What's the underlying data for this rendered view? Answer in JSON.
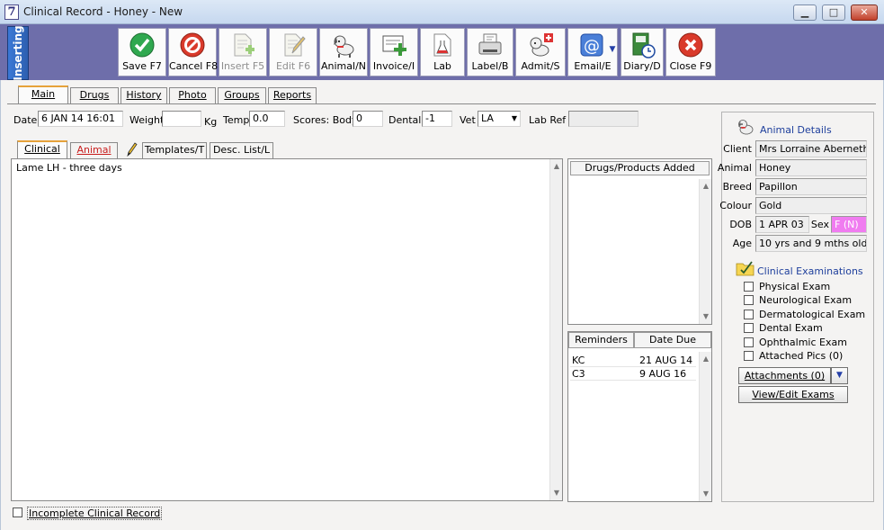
{
  "window": {
    "title": "Clinical Record - Honey - New",
    "icon_text": "7"
  },
  "mode_badge": "Inserting",
  "toolbar": [
    {
      "label": "Save F7",
      "icon": "check-icon",
      "color": "#2fa84f"
    },
    {
      "label": "Cancel F8",
      "icon": "cancel-icon",
      "color": "#d93a2b"
    },
    {
      "label": "Insert F5",
      "icon": "insert-document-icon",
      "disabled": true
    },
    {
      "label": "Edit F6",
      "icon": "edit-document-icon",
      "disabled": true
    },
    {
      "label": "Animal/N",
      "icon": "dog-icon"
    },
    {
      "label": "Invoice/I",
      "icon": "invoice-icon"
    },
    {
      "label": "Lab",
      "icon": "lab-flask-icon"
    },
    {
      "label": "Label/B",
      "icon": "label-printer-icon"
    },
    {
      "label": "Admit/S",
      "icon": "admit-dog-icon"
    },
    {
      "label": "Email/E",
      "icon": "email-at-icon"
    },
    {
      "label": "Diary/D",
      "icon": "diary-icon"
    },
    {
      "label": "Close F9",
      "icon": "close-x-icon",
      "color": "#d93a2b"
    }
  ],
  "main_tabs": [
    "Main",
    "Drugs",
    "History",
    "Photo",
    "Groups",
    "Reports"
  ],
  "record": {
    "date_label": "Date",
    "date_value": "6 JAN 14  16:01",
    "weight_label": "Weight",
    "weight_value": "",
    "weight_unit": "Kg",
    "temp_label": "Temp",
    "temp_value": "0.0",
    "scores_body_label": "Scores: Body",
    "scores_body_value": "0",
    "dental_label": "Dental",
    "dental_value": "-1",
    "vet_label": "Vet",
    "vet_value": "LA",
    "labref_label": "Lab Ref",
    "labref_value": ""
  },
  "sub_tabs": {
    "clinical": "Clinical",
    "animal": "Animal",
    "templates": "Templates/T",
    "desc_list": "Desc. List/L"
  },
  "notes_text": "Lame LH - three days",
  "drugs_panel": {
    "header": "Drugs/Products Added"
  },
  "reminders": {
    "headers": [
      "Reminders",
      "Date Due"
    ],
    "rows": [
      [
        "KC",
        "21 AUG 14"
      ],
      [
        "C3",
        "9 AUG 16"
      ]
    ]
  },
  "incomplete_label": "Incomplete Clinical Record",
  "animal_details": {
    "title": "Animal Details",
    "client_label": "Client",
    "client": "Mrs Lorraine Abernethy",
    "animal_label": "Animal",
    "animal": "Honey",
    "breed_label": "Breed",
    "breed": "Papillon",
    "colour_label": "Colour",
    "colour": "Gold",
    "dob_label": "DOB",
    "dob": "1 APR 03",
    "sex_label": "Sex",
    "sex": "F (N)",
    "sex_color": "#f07cf0",
    "age_label": "Age",
    "age": "10 yrs and 9 mths old"
  },
  "exams": {
    "title": "Clinical Examinations",
    "items": [
      "Physical Exam",
      "Neurological Exam",
      "Dermatological Exam",
      "Dental Exam",
      "Ophthalmic Exam",
      "Attached Pics (0)"
    ],
    "attachments_label": "Attachments (0)",
    "view_edit_label": "View/Edit Exams"
  }
}
